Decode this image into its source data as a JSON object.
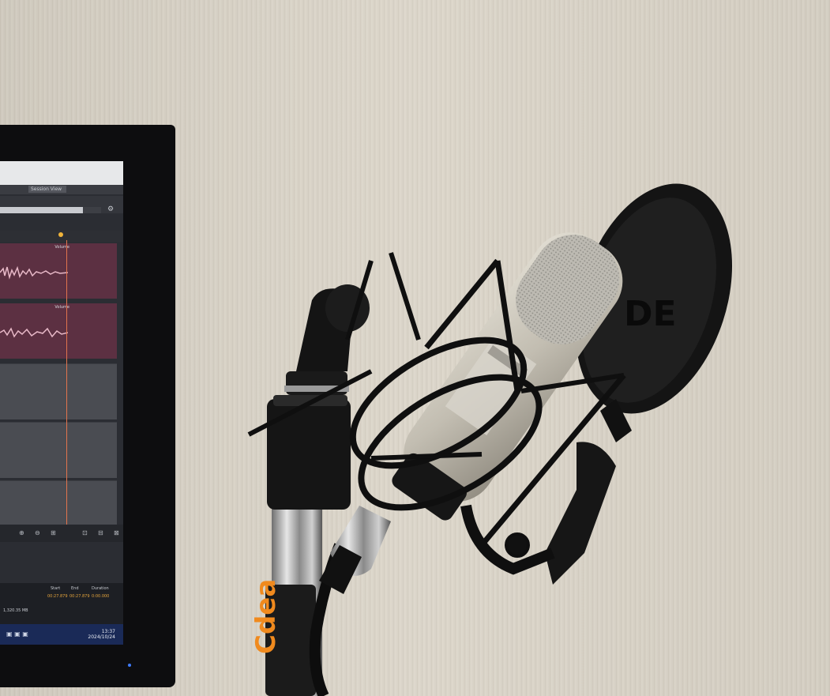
{
  "photo": {
    "subject": "microphone-in-shock-mount-with-pop-filter",
    "colors": {
      "wall": "#d8d2c6",
      "mic_body": "#c8c4b8",
      "stand_label": "#f08a1e",
      "playhead": "#e2744e"
    }
  },
  "pop_filter": {
    "brand_text": "DE"
  },
  "stand": {
    "brand_text": "Cdea"
  },
  "monitor": {
    "daw": {
      "tab_label": "Session View",
      "tracks": [
        {
          "label": "Volume"
        },
        {
          "label": "Volume"
        }
      ],
      "progress": 0.82,
      "info": {
        "headers": [
          "Start",
          "End",
          "Duration"
        ],
        "values": [
          "00:27.879",
          "00:27.879",
          "0:00.000"
        ],
        "size": "1,320.35 MB"
      },
      "clock": {
        "time": "13:37",
        "date": "2024/10/24"
      }
    }
  }
}
